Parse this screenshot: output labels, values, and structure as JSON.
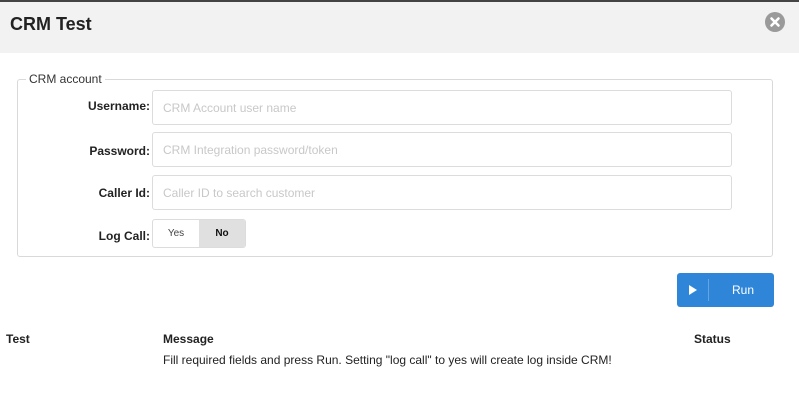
{
  "dialog": {
    "title": "CRM Test",
    "close_icon": "close-circle-icon"
  },
  "crm_account": {
    "legend": "CRM account",
    "username": {
      "label": "Username:",
      "value": "",
      "placeholder": "CRM Account user name"
    },
    "password": {
      "label": "Password:",
      "value": "",
      "placeholder": "CRM Integration password/token"
    },
    "caller_id": {
      "label": "Caller Id:",
      "value": "",
      "placeholder": "Caller ID to search customer"
    },
    "log_call": {
      "label": "Log Call:",
      "options": [
        "Yes",
        "No"
      ],
      "selected": "No"
    }
  },
  "run_button": {
    "label": "Run",
    "icon": "play-icon",
    "color": "#2f86d8"
  },
  "results_table": {
    "columns": [
      "Test",
      "Message",
      "Status"
    ],
    "rows": [
      {
        "test": "",
        "message": "Fill required fields and press Run. Setting \"log call\" to yes will create log inside CRM!",
        "status": ""
      }
    ]
  }
}
